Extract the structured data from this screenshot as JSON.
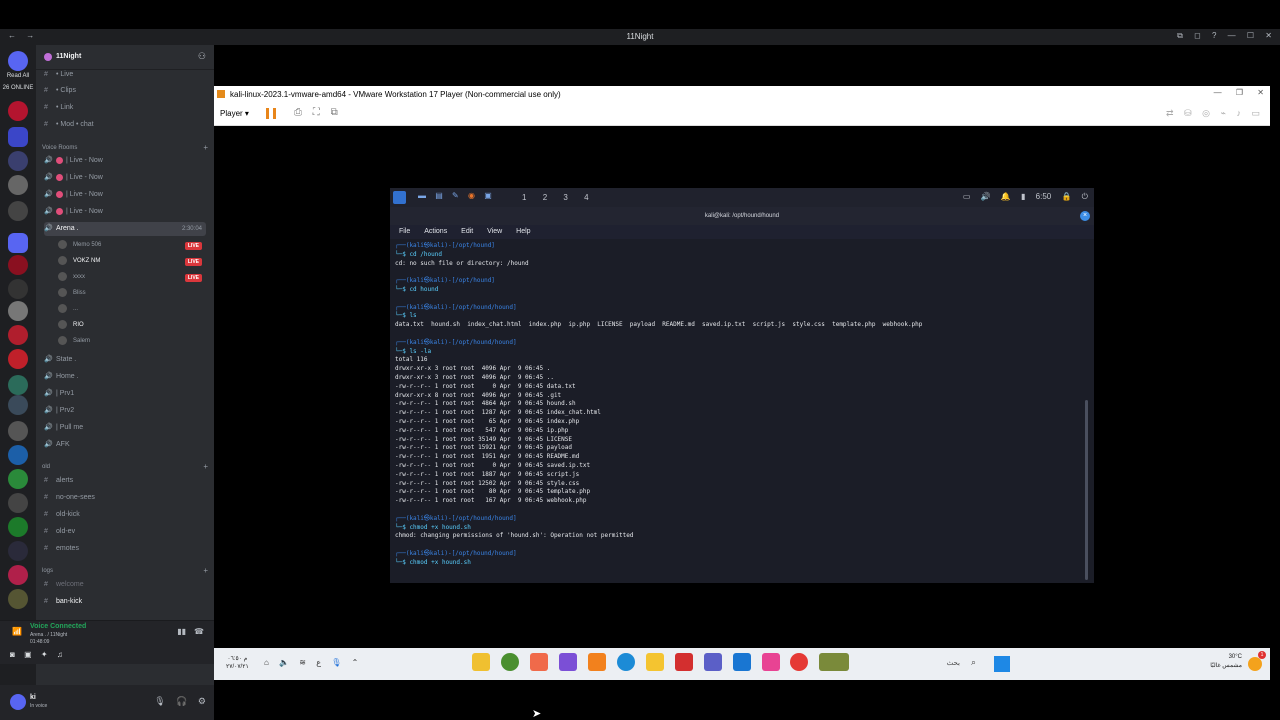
{
  "discord": {
    "window_title": "11Night",
    "nav": [
      "←",
      "→"
    ],
    "window_icons": [
      "⧉",
      "◻",
      "?"
    ],
    "window_controls": [
      "—",
      "☐",
      "✕"
    ],
    "server_labels": {
      "read_all": "Read All",
      "online": "26 ONLINE"
    },
    "guild_name": "11Night",
    "channels": [
      {
        "name": "• Live"
      },
      {
        "name": "• Clips"
      },
      {
        "name": "• Link"
      },
      {
        "name": "• Mod • chat"
      }
    ],
    "voice_category": "Voice Rooms",
    "voice_rooms": [
      {
        "name": "| Live - Now"
      },
      {
        "name": "| Live - Now"
      },
      {
        "name": "| Live - Now"
      },
      {
        "name": "| Live - Now"
      }
    ],
    "arena": {
      "name": "Arena .",
      "time": "2:30:04"
    },
    "arena_users": [
      {
        "name": "Memo",
        "extra": "506",
        "live": "LIVE"
      },
      {
        "name": "VOKZ",
        "extra": "NM",
        "live": "LIVE"
      },
      {
        "name": "xxxx",
        "extra": "",
        "live": "LIVE"
      },
      {
        "name": "Bliss",
        "extra": "",
        "live": ""
      },
      {
        "name": "...",
        "extra": "",
        "live": ""
      },
      {
        "name": "RIO",
        "extra": "",
        "live": ""
      },
      {
        "name": "Salem",
        "extra": "",
        "live": ""
      }
    ],
    "more_channels": [
      {
        "name": "State ."
      },
      {
        "name": "Home ."
      },
      {
        "name": "| Prv1"
      },
      {
        "name": "| Prv2"
      },
      {
        "name": "| Pull me"
      },
      {
        "name": "AFK"
      }
    ],
    "old_category": "old",
    "old_channels": [
      {
        "name": "alerts"
      },
      {
        "name": "no-one-sees"
      },
      {
        "name": "old-kick"
      },
      {
        "name": "old-ev"
      },
      {
        "name": "emotes"
      }
    ],
    "logs_category": "logs",
    "logs_channels": [
      {
        "name": "welcome"
      },
      {
        "name": "ban-kick"
      }
    ],
    "voice_connected": {
      "status": "Voice Connected",
      "channel": "Arena . / 11Night",
      "time": "01:48:09"
    },
    "user": {
      "name": "ki",
      "status": "In voice"
    }
  },
  "vmware": {
    "title": "kali-linux-2023.1-vmware-amd64 - VMware Workstation 17 Player (Non-commercial use only)",
    "player_label": "Player ▾",
    "controls": [
      "—",
      "❐",
      "✕"
    ]
  },
  "kali": {
    "workspaces": [
      "1",
      "2",
      "3",
      "4"
    ],
    "clock": "6:50",
    "terminal_title": "kali@kali: /opt/hound/hound",
    "menu": [
      "File",
      "Actions",
      "Edit",
      "View",
      "Help"
    ],
    "terminal_lines": [
      {
        "type": "p1",
        "text": "┌──(kali㉿kali)-[/opt/hound]"
      },
      {
        "type": "p2",
        "text": "└─$ cd /hound"
      },
      {
        "type": "out",
        "text": "cd: no such file or directory: /hound"
      },
      {
        "type": "blank",
        "text": " "
      },
      {
        "type": "p1",
        "text": "┌──(kali㉿kali)-[/opt/hound]"
      },
      {
        "type": "p2",
        "text": "└─$ cd hound"
      },
      {
        "type": "blank",
        "text": " "
      },
      {
        "type": "p1",
        "text": "┌──(kali㉿kali)-[/opt/hound/hound]"
      },
      {
        "type": "p2",
        "text": "└─$ ls"
      },
      {
        "type": "out",
        "text": "data.txt  hound.sh  index_chat.html  index.php  ip.php  LICENSE  payload  README.md  saved.ip.txt  script.js  style.css  template.php  webhook.php"
      },
      {
        "type": "blank",
        "text": " "
      },
      {
        "type": "p1",
        "text": "┌──(kali㉿kali)-[/opt/hound/hound]"
      },
      {
        "type": "p2",
        "text": "└─$ ls -la"
      },
      {
        "type": "out",
        "text": "total 116"
      },
      {
        "type": "out",
        "text": "drwxr-xr-x 3 root root  4096 Apr  9 06:45 ."
      },
      {
        "type": "out",
        "text": "drwxr-xr-x 3 root root  4096 Apr  9 06:45 .."
      },
      {
        "type": "out",
        "text": "-rw-r--r-- 1 root root     0 Apr  9 06:45 data.txt"
      },
      {
        "type": "out",
        "text": "drwxr-xr-x 8 root root  4096 Apr  9 06:45 .git"
      },
      {
        "type": "out",
        "text": "-rw-r--r-- 1 root root  4864 Apr  9 06:45 hound.sh"
      },
      {
        "type": "out",
        "text": "-rw-r--r-- 1 root root  1287 Apr  9 06:45 index_chat.html"
      },
      {
        "type": "out",
        "text": "-rw-r--r-- 1 root root    65 Apr  9 06:45 index.php"
      },
      {
        "type": "out",
        "text": "-rw-r--r-- 1 root root   547 Apr  9 06:45 ip.php"
      },
      {
        "type": "out",
        "text": "-rw-r--r-- 1 root root 35149 Apr  9 06:45 LICENSE"
      },
      {
        "type": "out",
        "text": "-rw-r--r-- 1 root root 15921 Apr  9 06:45 payload"
      },
      {
        "type": "out",
        "text": "-rw-r--r-- 1 root root  1951 Apr  9 06:45 README.md"
      },
      {
        "type": "out",
        "text": "-rw-r--r-- 1 root root     0 Apr  9 06:45 saved.ip.txt"
      },
      {
        "type": "out",
        "text": "-rw-r--r-- 1 root root  1887 Apr  9 06:45 script.js"
      },
      {
        "type": "out",
        "text": "-rw-r--r-- 1 root root 12502 Apr  9 06:45 style.css"
      },
      {
        "type": "out",
        "text": "-rw-r--r-- 1 root root    80 Apr  9 06:45 template.php"
      },
      {
        "type": "out",
        "text": "-rw-r--r-- 1 root root   167 Apr  9 06:45 webhook.php"
      },
      {
        "type": "blank",
        "text": " "
      },
      {
        "type": "p1",
        "text": "┌──(kali㉿kali)-[/opt/hound/hound]"
      },
      {
        "type": "p2",
        "text": "└─$ chmod +x hound.sh"
      },
      {
        "type": "out",
        "text": "chmod: changing permissions of 'hound.sh': Operation not permitted"
      },
      {
        "type": "blank",
        "text": " "
      },
      {
        "type": "p1",
        "text": "┌──(kali㉿kali)-[/opt/hound/hound]"
      },
      {
        "type": "p2",
        "text": "└─$ chmod +x hound.sh"
      }
    ]
  },
  "taskbar": {
    "time": "م ٠٦:٥٠",
    "date": "٢٧/٠٧/٢١",
    "lang": "ع",
    "search": "بحث",
    "temp": "30°C",
    "weather": "مشمس غالبًا",
    "notif_count": "1"
  }
}
